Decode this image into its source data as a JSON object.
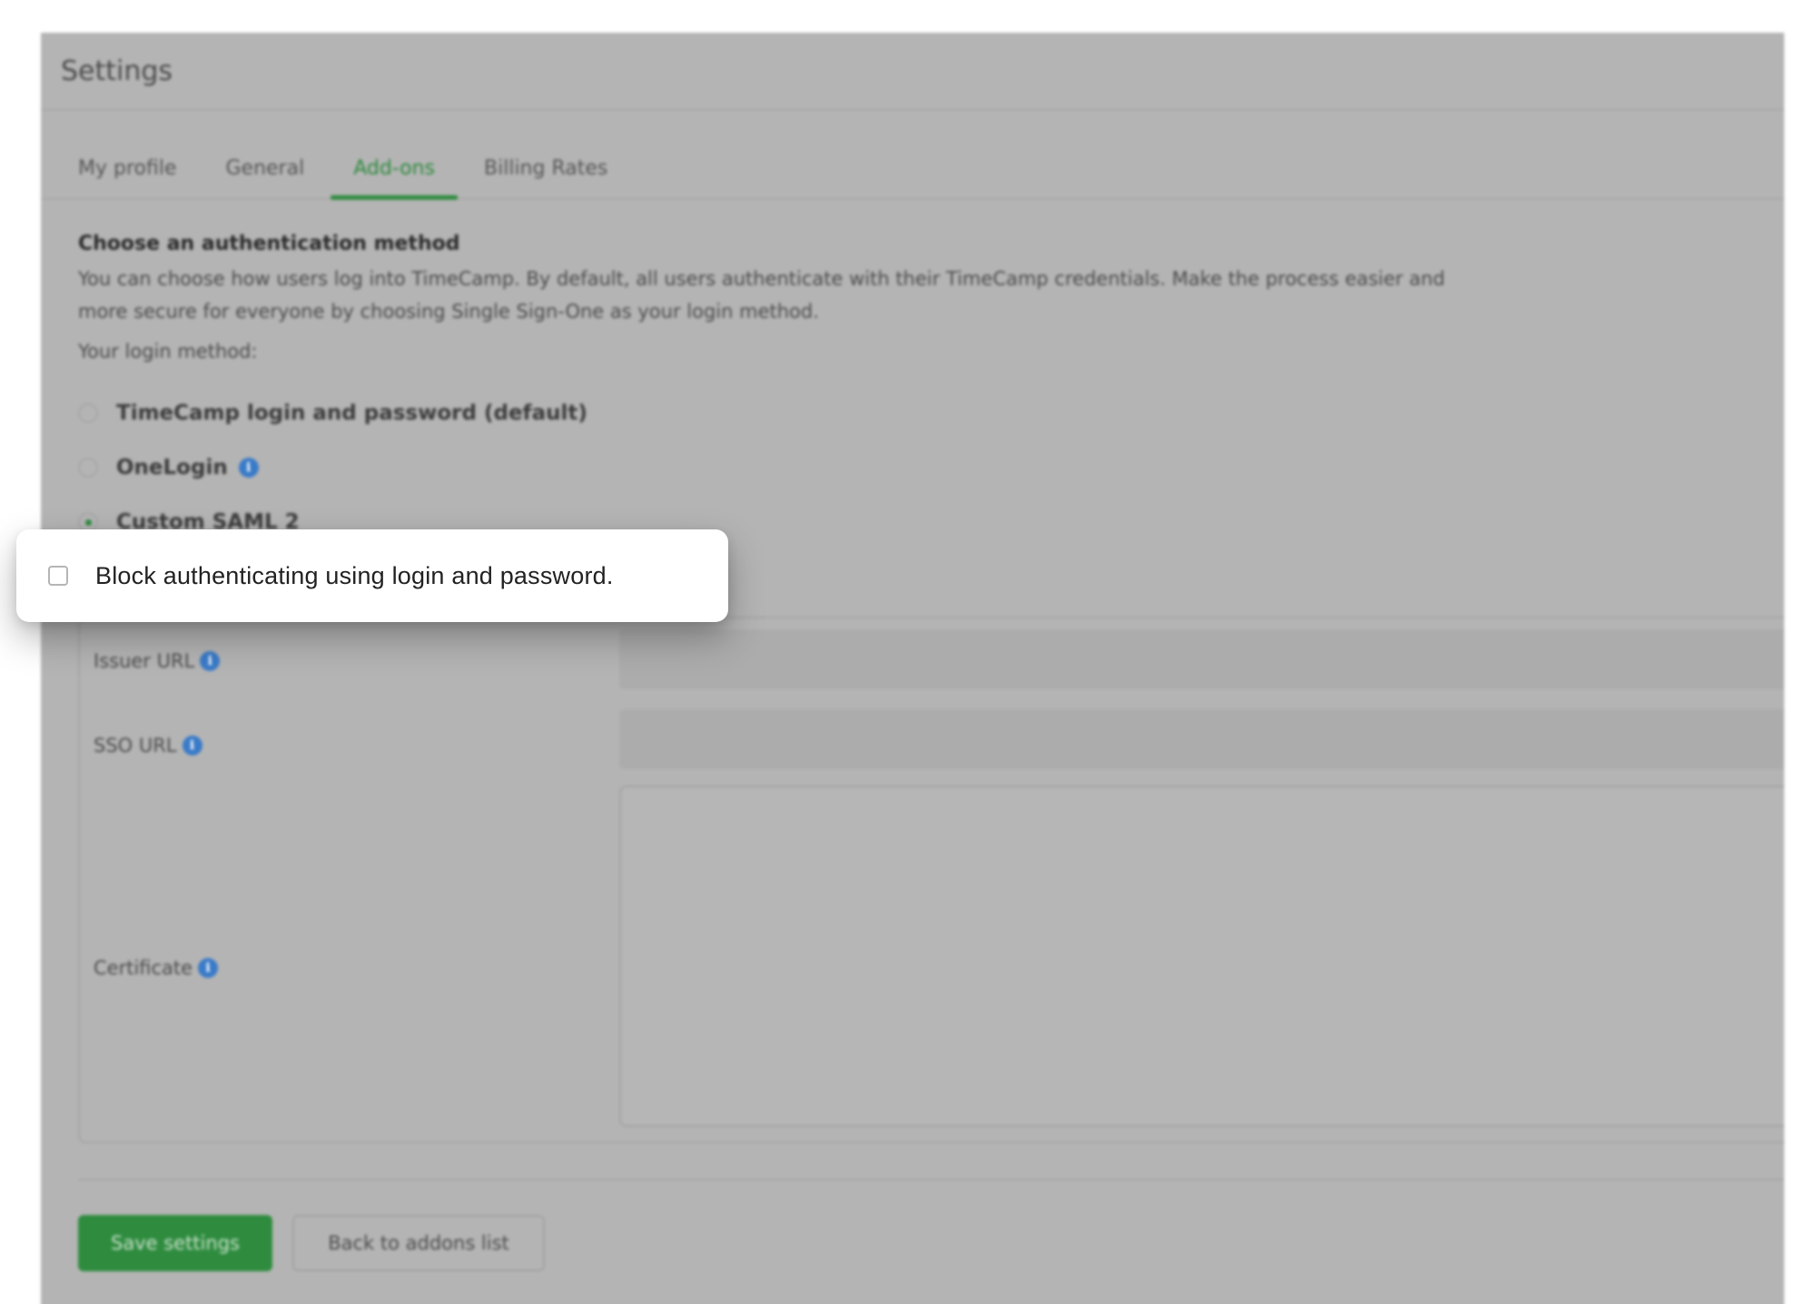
{
  "header": {
    "title": "Settings"
  },
  "tabs": [
    {
      "label": "My profile",
      "active": false
    },
    {
      "label": "General",
      "active": false
    },
    {
      "label": "Add-ons",
      "active": true
    },
    {
      "label": "Billing Rates",
      "active": false
    }
  ],
  "auth": {
    "heading": "Choose an authentication method",
    "description": "You can choose how users log into TimeCamp. By default, all users authenticate with their TimeCamp credentials. Make the process easier and more secure for everyone by choosing Single Sign-One as your login method.",
    "login_method_label": "Your login method:",
    "options": [
      {
        "label": "TimeCamp login and password (default)",
        "selected": false
      },
      {
        "label": "OneLogin",
        "selected": false
      },
      {
        "label": "Custom SAML 2",
        "selected": true
      }
    ]
  },
  "saml": {
    "issuer_url_label": "Issuer URL",
    "issuer_url_value": "",
    "sso_url_label": "SSO URL",
    "sso_url_value": "",
    "certificate_label": "Certificate",
    "certificate_value": ""
  },
  "actions": {
    "save_label": "Save settings",
    "back_label": "Back to addons list"
  },
  "callout": {
    "checkbox_label": "Block authenticating using login and password.",
    "checked": false
  },
  "colors": {
    "accent": "#2e8b3e",
    "info": "#3a7bc8",
    "overlay": "#b4b4b4"
  },
  "icons": {
    "info": "info-icon"
  }
}
